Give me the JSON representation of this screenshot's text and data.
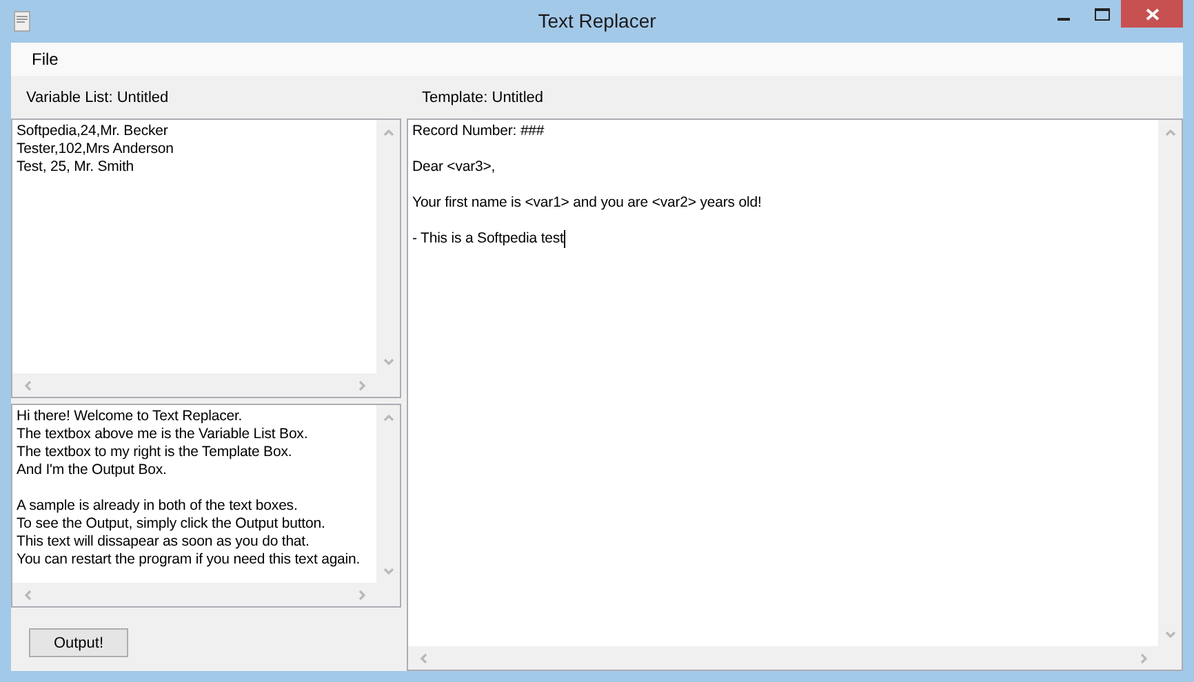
{
  "window": {
    "title": "Text Replacer"
  },
  "menu": [
    "File"
  ],
  "variable_list": {
    "label": "Variable List: Untitled",
    "text": "Softpedia,24,Mr. Becker\nTester,102,Mrs Anderson\nTest, 25, Mr. Smith"
  },
  "output": {
    "text": "Hi there! Welcome to Text Replacer.\nThe textbox above me is the Variable List Box.\nThe textbox to my right is the Template Box.\nAnd I'm the Output Box.\n\nA sample is already in both of the text boxes.\nTo see the Output, simply click the Output button.\nThis text will dissapear as soon as you do that.\nYou can restart the program if you need this text again."
  },
  "output_button": "Output!",
  "template": {
    "label": "Template: Untitled",
    "text": "Record Number: ###\n\nDear <var3>,\n\nYour first name is <var1> and you are <var2> years old!\n\n- This is a Softpedia test"
  }
}
